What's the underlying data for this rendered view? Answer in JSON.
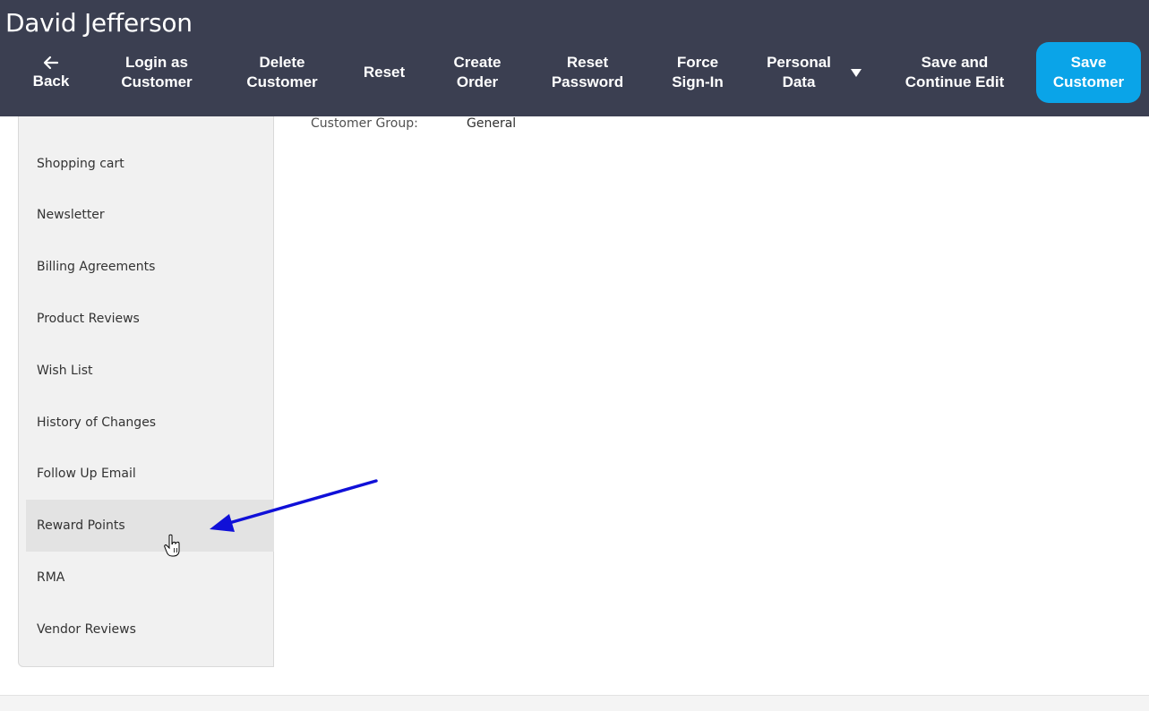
{
  "header": {
    "title": "David Jefferson",
    "actions": {
      "back": "Back",
      "login_as_customer": "Login as\nCustomer",
      "delete_customer": "Delete\nCustomer",
      "reset": "Reset",
      "create_order": "Create\nOrder",
      "reset_password": "Reset\nPassword",
      "force_sign_in": "Force\nSign-In",
      "personal_data": "Personal\nData",
      "save_and_continue": "Save and\nContinue Edit",
      "save_customer": "Save\nCustomer"
    }
  },
  "customer_info": {
    "group_label": "Customer Group:",
    "group_value": "General"
  },
  "sidebar": {
    "items": [
      {
        "label": "Shopping cart"
      },
      {
        "label": "Newsletter"
      },
      {
        "label": "Billing Agreements"
      },
      {
        "label": "Product Reviews"
      },
      {
        "label": "Wish List"
      },
      {
        "label": "History of Changes"
      },
      {
        "label": "Follow Up Email"
      },
      {
        "label": "Reward Points",
        "active": true
      },
      {
        "label": "RMA"
      },
      {
        "label": "Vendor Reviews"
      }
    ]
  },
  "colors": {
    "header_bg": "#3b3f51",
    "primary": "#0aa4e8",
    "annotation_arrow": "#1010d8"
  },
  "icons": {
    "back": "arrow-left-icon",
    "dropdown": "caret-down-icon",
    "cursor": "hand-pointer-icon"
  }
}
